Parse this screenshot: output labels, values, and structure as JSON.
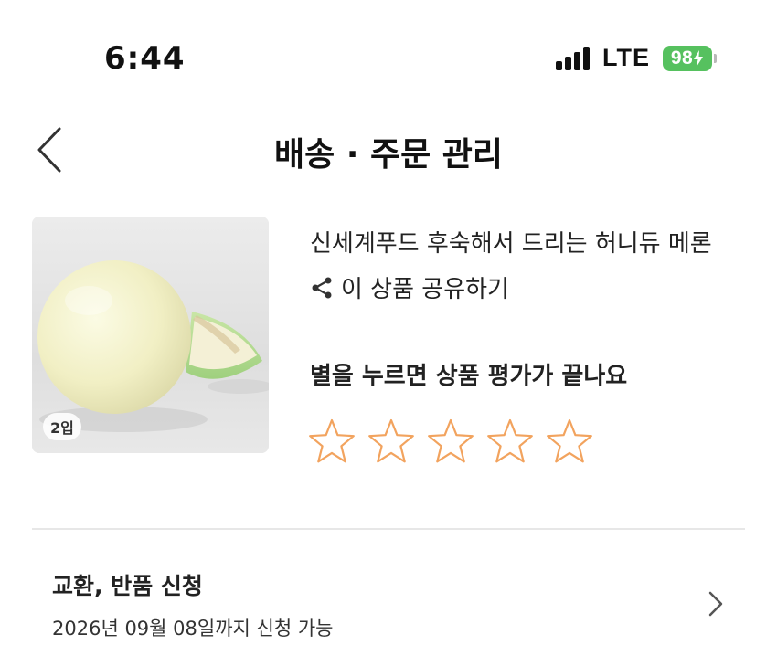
{
  "status_bar": {
    "time": "6:44",
    "network": "LTE",
    "battery": "98",
    "battery_color": "#56c15f"
  },
  "header": {
    "back_icon": "chevron-left-icon",
    "title": "배송 · 주문 관리"
  },
  "product": {
    "image_desc": "honeydew-melon-photo",
    "count_badge": "2입",
    "name": "신세계푸드 후숙해서 드리는 허니듀 메론",
    "share_icon": "share-icon",
    "share_label": "이 상품 공유하기"
  },
  "rating": {
    "prompt": "별을 누르면 상품 평가가 끝나요",
    "max_stars": 5,
    "selected": 0,
    "star_outline_color": "#f2a35e"
  },
  "return_section": {
    "title": "교환, 반품 신청",
    "subtitle": "2026년 09월 08일까지 신청 가능",
    "chevron_icon": "chevron-right-icon"
  }
}
